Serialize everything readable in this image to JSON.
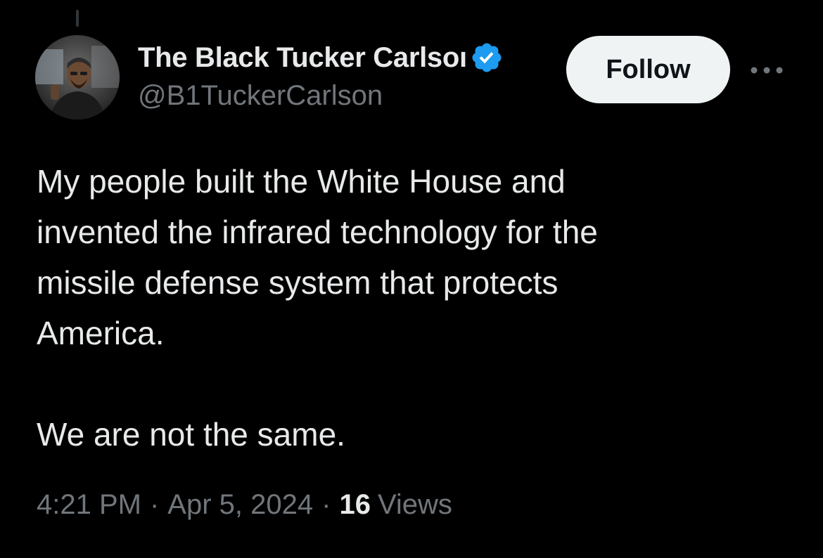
{
  "tweet": {
    "author": {
      "display_name": "The Black Tucker Carlsoı",
      "handle": "@B1TuckerCarlson",
      "verified": true,
      "avatar_icon": "user-avatar"
    },
    "follow_label": "Follow",
    "more_icon": "more-horizontal-icon",
    "text_lines": [
      "My people built the White House and",
      "invented the infrared technology for the",
      "missile defense system that protects",
      "America."
    ],
    "text_closing": "We are not the same.",
    "time": "4:21 PM",
    "separator": "·",
    "date": "Apr 5, 2024",
    "views_count": "16",
    "views_label": "Views"
  },
  "colors": {
    "background": "#000000",
    "text_primary": "#e7e9ea",
    "text_secondary": "#71767b",
    "verified_blue": "#1d9bf0",
    "follow_bg": "#eff3f4",
    "follow_text": "#0f1419"
  }
}
